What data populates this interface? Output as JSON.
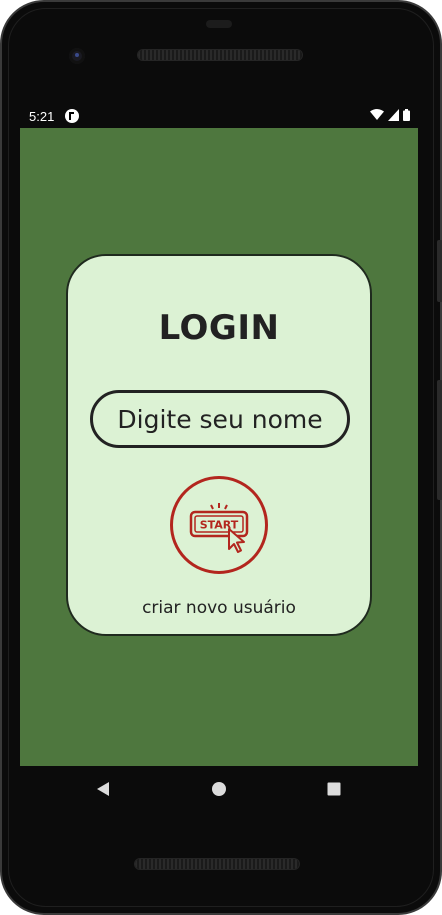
{
  "status_bar": {
    "time": "5:21",
    "icons": [
      "app-notification-icon",
      "wifi-icon",
      "signal-icon",
      "battery-icon"
    ]
  },
  "colors": {
    "screen_background": "#4e773e",
    "card_background": "#dcf2d4",
    "card_border": "#1f2a1e",
    "accent_red": "#b3261e",
    "text": "#222222"
  },
  "login": {
    "title": "LOGIN",
    "name_input": {
      "placeholder": "Digite seu nome",
      "value": ""
    },
    "start_button": {
      "icon": "start-button-cursor-icon",
      "label": "START"
    },
    "create_user_label": "criar novo usuário"
  },
  "nav_bar": {
    "buttons": [
      "back",
      "home",
      "recents"
    ]
  }
}
